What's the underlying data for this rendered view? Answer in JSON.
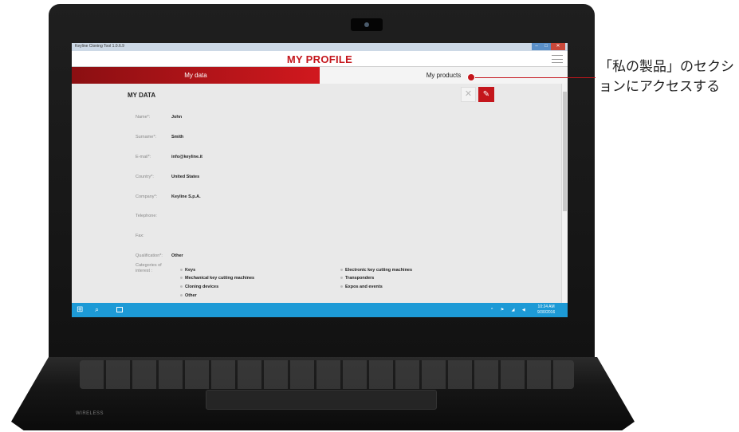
{
  "window": {
    "app_title": "Keyline Cloning Tool 1.0.6.9",
    "controls": [
      "–",
      "□",
      "✕"
    ]
  },
  "header": {
    "title": "MY PROFILE",
    "menu_icon": "hamburger-icon"
  },
  "tabs": [
    {
      "label": "My data",
      "active": true
    },
    {
      "label": "My products",
      "active": false
    }
  ],
  "section": {
    "title": "MY DATA",
    "cancel_icon": "close-icon",
    "edit_icon": "pencil-icon"
  },
  "fields": [
    {
      "label": "Name*:",
      "value": "John"
    },
    {
      "label": "Surname*:",
      "value": "Smith"
    },
    {
      "label": "E-mail*:",
      "value": "info@keyline.it"
    },
    {
      "label": "Country*:",
      "value": "United States"
    },
    {
      "label": "Company*:",
      "value": "Keyline S.p.A."
    },
    {
      "label": "Telephone:",
      "value": ""
    },
    {
      "label": "Fax:",
      "value": ""
    },
    {
      "label": "Qualification*:",
      "value": "Other"
    }
  ],
  "categories": {
    "label": "Categories of interest :",
    "items": [
      "Keys",
      "Mechanical key cutting machines",
      "Cloning devices",
      "Other",
      "Electronic key cutting machines",
      "Transponders",
      "Expos and events"
    ]
  },
  "taskbar": {
    "time": "10:24 AM",
    "date": "9/30/2016",
    "tray_icons": [
      "up-arrow-icon",
      "flag-icon",
      "network-icon",
      "volume-icon"
    ]
  },
  "callout": {
    "text": "「私の製品」のセクションにアクセスする"
  },
  "laptop": {
    "status_text": "WIRELESS"
  },
  "colors": {
    "brand_red": "#c4161c",
    "taskbar_blue": "#1d9ad6"
  }
}
